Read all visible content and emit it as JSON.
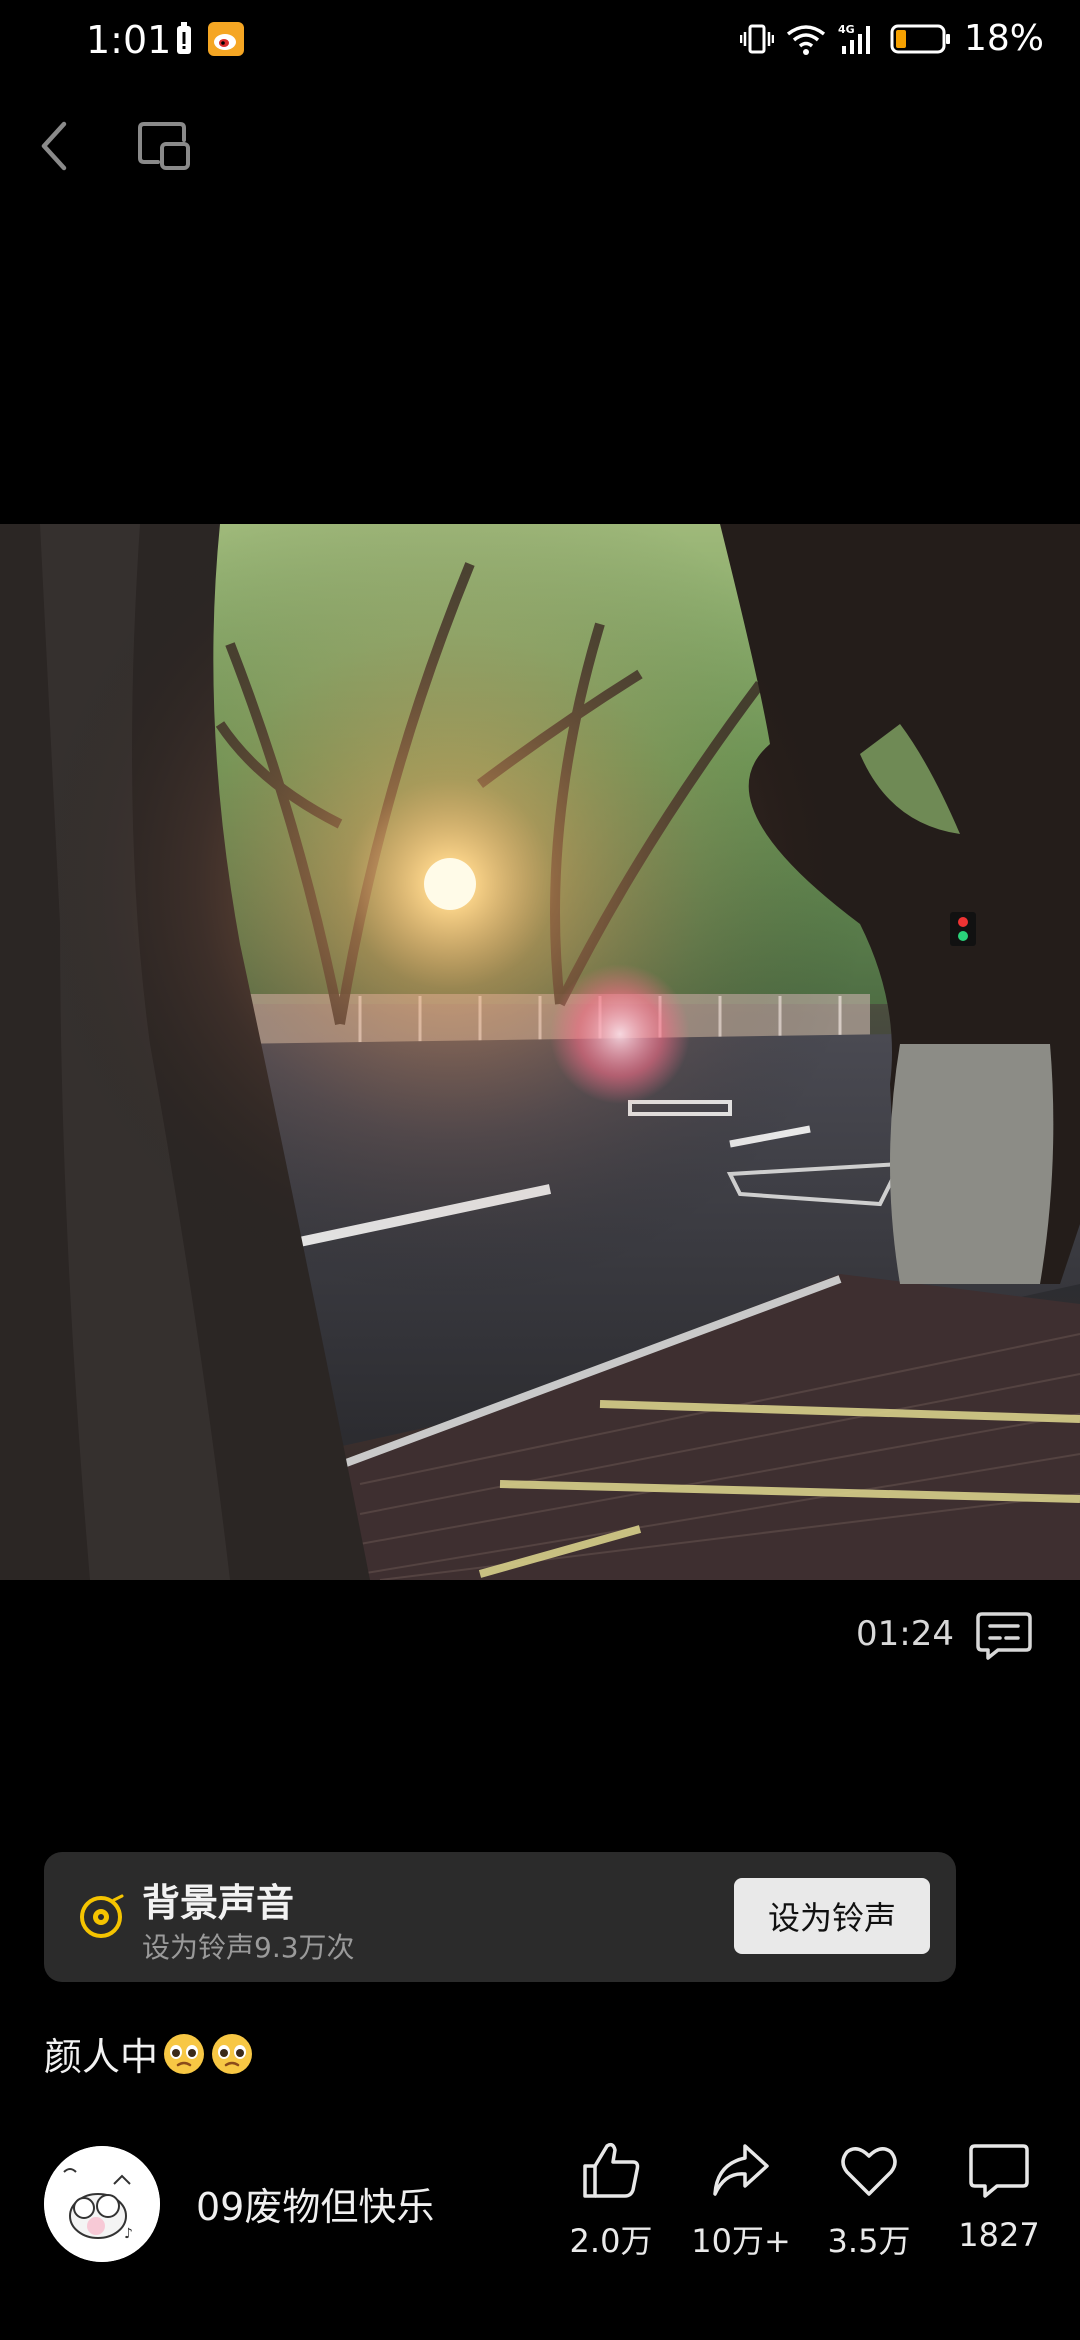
{
  "status_bar": {
    "time": "1:01",
    "battery": "18%",
    "network": "4G"
  },
  "video": {
    "time": "01:24"
  },
  "sound": {
    "title": "背景声音",
    "subtitle": "设为铃声9.3万次",
    "button_label": "设为铃声"
  },
  "caption": {
    "text": "颜人中"
  },
  "author": {
    "name": "09废物但快乐"
  },
  "actions": {
    "like_count": "2.0万",
    "share_count": "10万+",
    "favorite_count": "3.5万",
    "comment_count": "1827"
  },
  "colors": {
    "background": "#000000",
    "card": "#2b2b2b",
    "button": "#e9e9e9",
    "accent": "#f5c400"
  }
}
